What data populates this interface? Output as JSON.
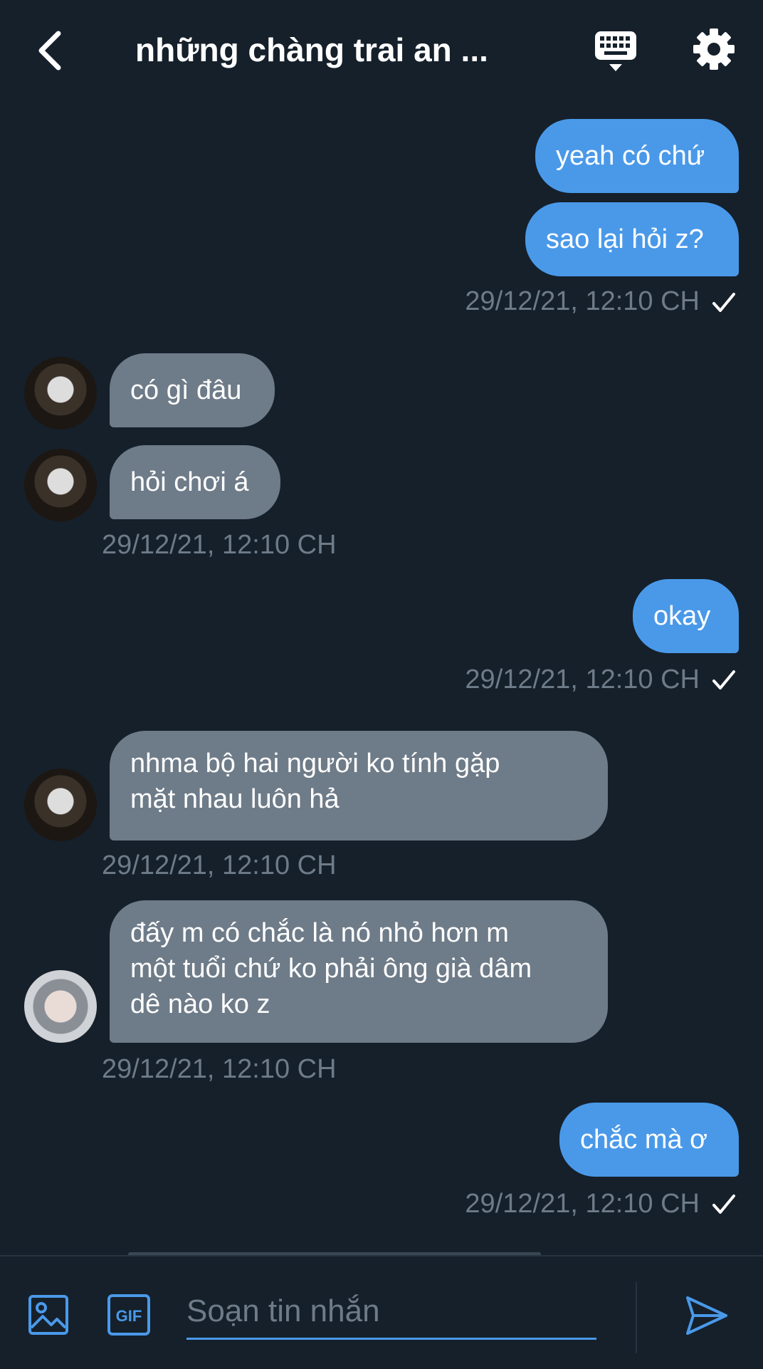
{
  "header": {
    "title": "những chàng trai an ...",
    "back_icon": "chevron-left-icon",
    "keyboard_icon": "keyboard-icon",
    "settings_icon": "gear-icon"
  },
  "messages": [
    {
      "id": "m1",
      "direction": "outgoing",
      "text": "yeah có chứ"
    },
    {
      "id": "m2",
      "direction": "outgoing",
      "text": "sao lại hỏi z?"
    },
    {
      "id": "t1",
      "type": "timestamp",
      "direction": "outgoing",
      "text": "29/12/21, 12:10 CH",
      "read": true
    },
    {
      "id": "m3",
      "direction": "incoming",
      "text": "có gì đâu"
    },
    {
      "id": "m4",
      "direction": "incoming",
      "text": "hỏi chơi á"
    },
    {
      "id": "t2",
      "type": "timestamp",
      "direction": "incoming",
      "text": "29/12/21, 12:10 CH"
    },
    {
      "id": "m5",
      "direction": "outgoing",
      "text": "okay"
    },
    {
      "id": "t3",
      "type": "timestamp",
      "direction": "outgoing",
      "text": "29/12/21, 12:10 CH",
      "read": true
    },
    {
      "id": "m6",
      "direction": "incoming",
      "lines": [
        "nhma bộ hai người ko tính gặp",
        "mặt nhau luôn hả"
      ]
    },
    {
      "id": "t4",
      "type": "timestamp",
      "direction": "incoming",
      "text": "29/12/21, 12:10 CH"
    },
    {
      "id": "m7",
      "direction": "incoming",
      "lines": [
        "đấy m có chắc là nó nhỏ hơn m",
        "một tuổi chứ ko phải ông già dâm",
        "dê nào ko z"
      ]
    },
    {
      "id": "t5",
      "type": "timestamp",
      "direction": "incoming",
      "text": "29/12/21, 12:10 CH"
    },
    {
      "id": "m8",
      "direction": "outgoing",
      "text": "chắc mà ơ"
    },
    {
      "id": "t6",
      "type": "timestamp",
      "direction": "outgoing",
      "text": "29/12/21, 12:10 CH",
      "read": true
    }
  ],
  "composer": {
    "placeholder": "Soạn tin nhắn",
    "image_icon": "image-icon",
    "gif_label": "GIF",
    "send_icon": "send-icon"
  },
  "colors": {
    "background": "#15202b",
    "outgoing_bubble": "#4a99e9",
    "incoming_bubble": "#6e7b88",
    "timestamp": "#6e7b88",
    "accent": "#4a99e9"
  }
}
